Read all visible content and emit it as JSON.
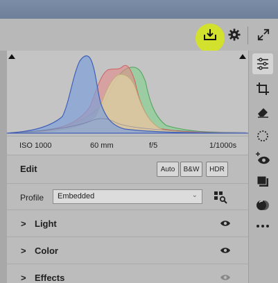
{
  "header": {
    "icons": [
      "save-icon",
      "gear-icon",
      "expand-icon"
    ]
  },
  "histogram": {
    "colors": {
      "blue": "#7f9fd8",
      "red": "#e58a8a",
      "green": "#8fcf95",
      "yellow": "#dfd4a6"
    }
  },
  "exif": {
    "iso": "ISO 1000",
    "focal": "60 mm",
    "aperture": "f/5",
    "shutter": "1/1000s"
  },
  "edit": {
    "title": "Edit",
    "auto_label": "Auto",
    "bw_label": "B&W",
    "hdr_label": "HDR"
  },
  "profile": {
    "label": "Profile",
    "value": "Embedded"
  },
  "sections": [
    {
      "label": "Light"
    },
    {
      "label": "Color"
    },
    {
      "label": "Effects"
    }
  ],
  "tools": [
    "sliders-icon",
    "crop-icon",
    "eraser-icon",
    "masking-icon",
    "redeye-icon",
    "presets-icon",
    "snapshots-icon",
    "more-icon"
  ]
}
